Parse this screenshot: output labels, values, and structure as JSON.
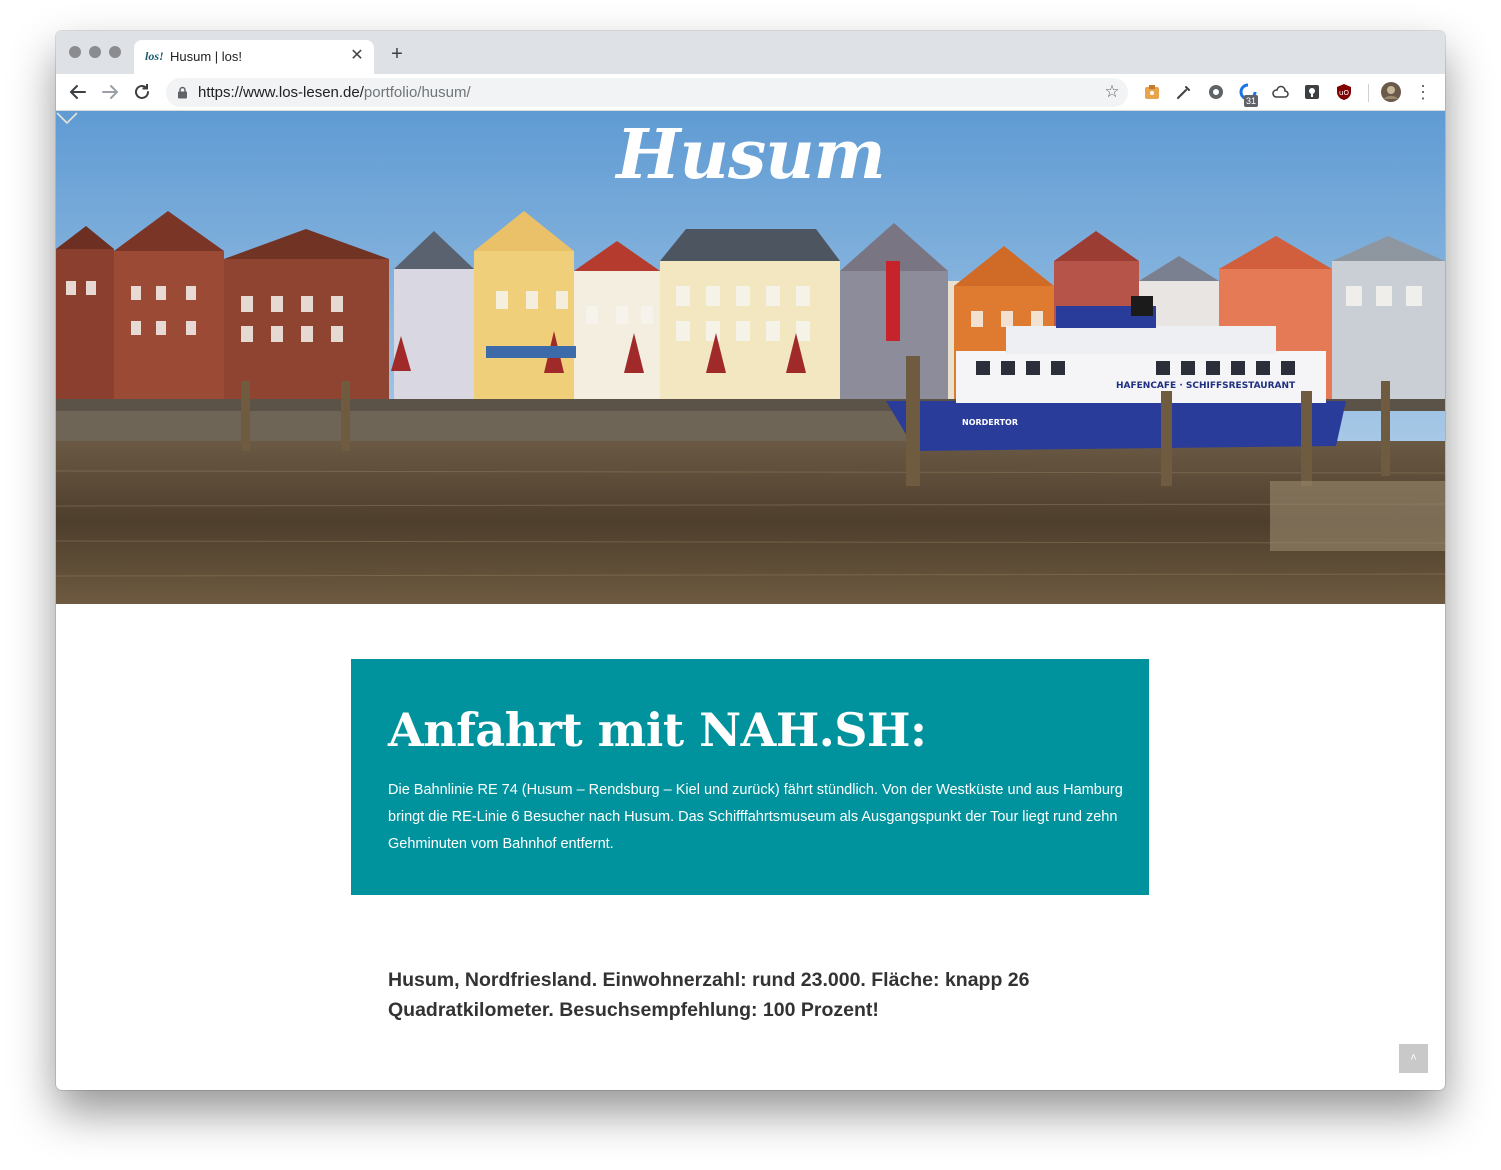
{
  "browser": {
    "tab_favicon_text": "los!",
    "tab_title": "Husum | los!",
    "tab_close": "✕",
    "new_tab": "+",
    "url_host": "https://www.los-lesen.de/",
    "url_path": "portfolio/husum/",
    "bookmark_star": "☆",
    "calendar_badge": "31",
    "menu_dots": "⋮"
  },
  "hero": {
    "title": "Husum",
    "ship_name": "HAFENCAFE · SCHIFFSRESTAURANT",
    "hull_name": "NORDERTOR"
  },
  "info_box": {
    "heading": "Anfahrt mit NAH.SH:",
    "text": "Die Bahnlinie RE 74 (Husum – Rendsburg – Kiel und zurück) fährt stündlich. Von der Westküste und aus Hamburg bringt die RE-Linie 6 Besucher nach Husum. Das Schifffahrtsmuseum als Ausgangspunkt der Tour liegt rund zehn Gehminuten vom Bahnhof entfernt."
  },
  "intro": {
    "text": "Husum, Nordfriesland. Einwohnerzahl: rund 23.000. Fläche: knapp 26 Quadratkilometer. Besuchsempfehlung: 100 Prozent!"
  },
  "back_to_top": "˄",
  "colors": {
    "info_box_bg": "#00939e",
    "sky": "#6fa6d6",
    "water": "#5e4a35"
  }
}
